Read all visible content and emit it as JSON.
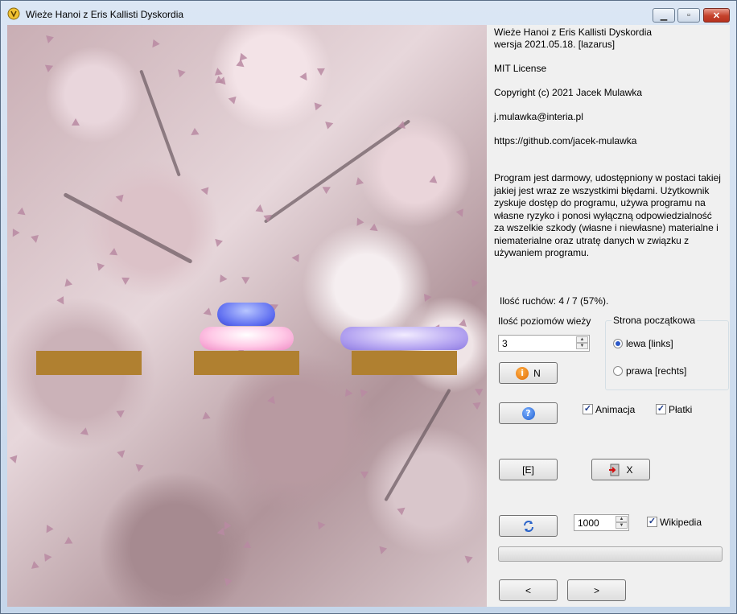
{
  "window": {
    "title": "Wieże Hanoi z Eris Kallisti Dyskordia",
    "minimize_glyph": "▁",
    "maximize_glyph": "▫",
    "close_glyph": "✕"
  },
  "about": {
    "line1": "Wieże Hanoi z Eris Kallisti Dyskordia",
    "line2": "wersja 2021.05.18. [lazarus]",
    "license": "MIT License",
    "copyright": "Copyright (c) 2021 Jacek Mulawka",
    "email": "j.mulawka@interia.pl",
    "url": "https://github.com/jacek-mulawka",
    "disclaimer": "Program jest darmowy, udostępniony w postaci takiej jakiej jest wraz ze wszystkimi błędami. Użytkownik zyskuje dostęp do programu, używa programu na własne ryzyko i ponosi wyłączną odpowiedzialność za wszelkie szkody (własne i niewłasne) materialne i niematerialne oraz utratę danych w związku z używaniem programu."
  },
  "moves": {
    "label": "Ilość ruchów: 4 / 7 (57%)."
  },
  "levels": {
    "label": "Ilość poziomów wieży",
    "value": "3"
  },
  "start_side": {
    "label": "Strona początkowa",
    "left_option": "lewa [links]",
    "right_option": "prawa [rechts]",
    "selected": "left"
  },
  "buttons": {
    "new_label": "N",
    "new_icon": "info-icon",
    "help_icon": "help-icon",
    "e_label": "[E]",
    "exit_label": "X",
    "exit_icon": "exit-door-icon",
    "refresh_icon": "refresh-icon",
    "prev_label": "<",
    "next_label": ">"
  },
  "options": {
    "animation_label": "Animacja",
    "animation_checked": true,
    "petals_label": "Płatki",
    "petals_checked": true,
    "wikipedia_label": "Wikipedia",
    "wikipedia_checked": true
  },
  "speed": {
    "value": "1000"
  },
  "progress": {
    "fraction": 0.0
  },
  "board": {
    "pegs": 3,
    "disks": [
      {
        "size": 1,
        "peg": 2,
        "color": "#5d6cf0"
      },
      {
        "size": 2,
        "peg": 2,
        "color": "#ffc8e6"
      },
      {
        "size": 3,
        "peg": 3,
        "color": "#b7a7f2"
      }
    ],
    "peg_color": "#b08030",
    "petal_color": "#b889a2"
  }
}
